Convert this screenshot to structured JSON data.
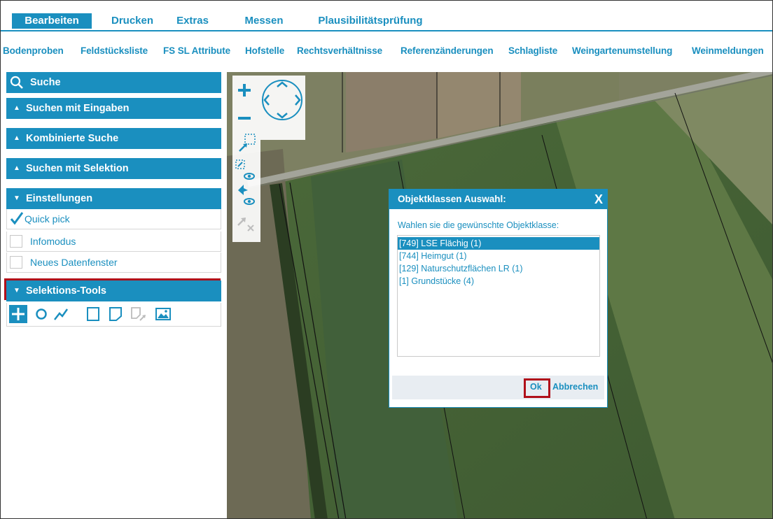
{
  "tabs": [
    {
      "label": "Bearbeiten",
      "active": true
    },
    {
      "label": "Drucken",
      "active": false
    },
    {
      "label": "Extras",
      "active": false
    },
    {
      "label": "Messen",
      "active": false
    },
    {
      "label": "Plausibilitätsprüfung",
      "active": false
    }
  ],
  "subnav": [
    "Bodenproben",
    "Feldstücksliste",
    "FS SL Attribute",
    "Hofstelle",
    "Rechtsverhältnisse",
    "Referenzänderungen",
    "Schlagliste",
    "Weingartenumstellung",
    "Weinmeldungen"
  ],
  "panel": {
    "search_title": "Suche",
    "sections": [
      "Suchen mit Eingaben",
      "Kombinierte Suche",
      "Suchen mit Selektion"
    ],
    "settings_title": "Einstellungen",
    "options": [
      {
        "label": "Quick pick",
        "checked": true
      },
      {
        "label": "Infomodus",
        "checked": false
      },
      {
        "label": "Neues Datenfenster",
        "checked": false
      }
    ],
    "tools_title": "Selektions-Tools",
    "tool_icons": [
      "point-tool-icon",
      "circle-tool-icon",
      "line-tool-icon",
      "rectangle-tool-icon",
      "polygon-tool-icon",
      "polygon-select-icon",
      "image-tool-icon"
    ]
  },
  "dialog": {
    "title": "Objektklassen Auswahl:",
    "close": "X",
    "prompt": "Wahlen sie die gewünschte Objektklasse:",
    "items": [
      {
        "label": "[749] LSE Flächig (1)",
        "selected": true
      },
      {
        "label": "[744] Heimgut (1)",
        "selected": false
      },
      {
        "label": "[129] Naturschutzflächen LR (1)",
        "selected": false
      },
      {
        "label": "[1] Grundstücke (4)",
        "selected": false
      }
    ],
    "ok": "Ok",
    "cancel": "Abbrechen"
  },
  "colors": {
    "accent": "#1a8fbf",
    "highlight": "#b0101a"
  }
}
